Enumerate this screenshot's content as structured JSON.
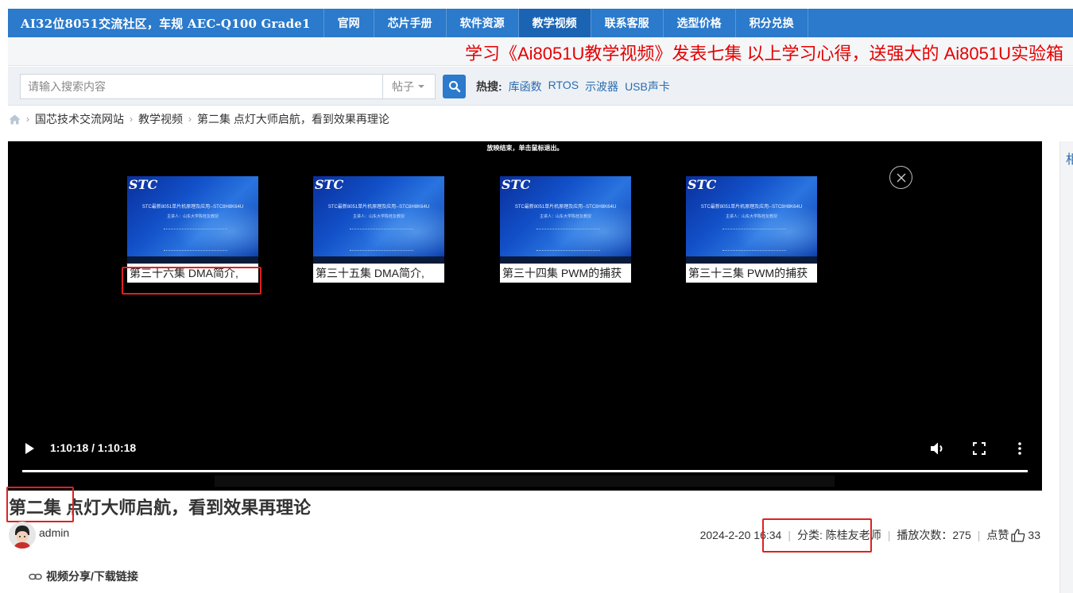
{
  "nav": {
    "brand": "AI32位8051交流社区，车规 AEC-Q100 Grade1",
    "items": [
      {
        "label": "官网"
      },
      {
        "label": "芯片手册"
      },
      {
        "label": "软件资源"
      },
      {
        "label": "教学视频",
        "active": true
      },
      {
        "label": "联系客服"
      },
      {
        "label": "选型价格"
      },
      {
        "label": "积分兑换"
      }
    ],
    "color": "#2b7acb"
  },
  "announcement": "学习《Ai8051U教学视频》发表七集 以上学习心得，送强大的 Ai8051U实验箱",
  "search": {
    "placeholder": "请输入搜索内容",
    "type_label": "帖子",
    "hot_label": "热搜:",
    "hot_items": [
      "库函数",
      "RTOS",
      "示波器",
      "USB声卡"
    ]
  },
  "breadcrumb": {
    "home_icon": "home-icon",
    "items": [
      "国芯技术交流网站",
      "教学视频",
      "第二集 点灯大师启航，看到效果再理论"
    ]
  },
  "player": {
    "end_message": "放映结束，单击鼠标退出。",
    "thumbs": [
      {
        "caption": "第三十六集 DMA简介,",
        "logo": "STC",
        "line1": "STC最新8051单片机原理及应用--STC8H8K64U",
        "line2": "主讲人：山东大学陈桂友教授"
      },
      {
        "caption": "第三十五集 DMA简介,",
        "logo": "STC",
        "line1": "STC最新8051单片机原理及应用--STC8H8K64U",
        "line2": "主讲人：山东大学陈桂友教授"
      },
      {
        "caption": "第三十四集 PWM的捕获",
        "logo": "STC",
        "line1": "STC最新8051单片机原理及应用--STC8H8K64U",
        "line2": "主讲人：山东大学陈桂友教授"
      },
      {
        "caption": "第三十三集 PWM的捕获",
        "logo": "STC",
        "line1": "STC最新8051单片机原理及应用--STC8H8K64U",
        "line2": "主讲人：山东大学陈桂友教授"
      }
    ],
    "time": "1:10:18 / 1:10:18",
    "progress": 1.0
  },
  "video": {
    "title": "第二集 点灯大师启航，看到效果再理论",
    "author": "admin",
    "date": "2024-2-20 16:34",
    "category": "分类: 陈桂友老师",
    "plays": "播放次数：275",
    "likes_label": "点赞",
    "likes": "33"
  },
  "share_label": "视频分享/下载链接",
  "right_panel_char": "相",
  "highlight_color": "#e02020"
}
